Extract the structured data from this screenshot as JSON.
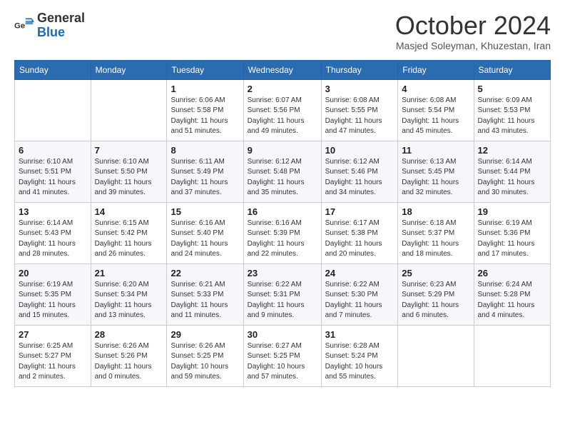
{
  "logo": {
    "general": "General",
    "blue": "Blue"
  },
  "title": "October 2024",
  "subtitle": "Masjed Soleyman, Khuzestan, Iran",
  "days_of_week": [
    "Sunday",
    "Monday",
    "Tuesday",
    "Wednesday",
    "Thursday",
    "Friday",
    "Saturday"
  ],
  "weeks": [
    [
      {
        "day": "",
        "sunrise": "",
        "sunset": "",
        "daylight": ""
      },
      {
        "day": "",
        "sunrise": "",
        "sunset": "",
        "daylight": ""
      },
      {
        "day": "1",
        "sunrise": "Sunrise: 6:06 AM",
        "sunset": "Sunset: 5:58 PM",
        "daylight": "Daylight: 11 hours and 51 minutes."
      },
      {
        "day": "2",
        "sunrise": "Sunrise: 6:07 AM",
        "sunset": "Sunset: 5:56 PM",
        "daylight": "Daylight: 11 hours and 49 minutes."
      },
      {
        "day": "3",
        "sunrise": "Sunrise: 6:08 AM",
        "sunset": "Sunset: 5:55 PM",
        "daylight": "Daylight: 11 hours and 47 minutes."
      },
      {
        "day": "4",
        "sunrise": "Sunrise: 6:08 AM",
        "sunset": "Sunset: 5:54 PM",
        "daylight": "Daylight: 11 hours and 45 minutes."
      },
      {
        "day": "5",
        "sunrise": "Sunrise: 6:09 AM",
        "sunset": "Sunset: 5:53 PM",
        "daylight": "Daylight: 11 hours and 43 minutes."
      }
    ],
    [
      {
        "day": "6",
        "sunrise": "Sunrise: 6:10 AM",
        "sunset": "Sunset: 5:51 PM",
        "daylight": "Daylight: 11 hours and 41 minutes."
      },
      {
        "day": "7",
        "sunrise": "Sunrise: 6:10 AM",
        "sunset": "Sunset: 5:50 PM",
        "daylight": "Daylight: 11 hours and 39 minutes."
      },
      {
        "day": "8",
        "sunrise": "Sunrise: 6:11 AM",
        "sunset": "Sunset: 5:49 PM",
        "daylight": "Daylight: 11 hours and 37 minutes."
      },
      {
        "day": "9",
        "sunrise": "Sunrise: 6:12 AM",
        "sunset": "Sunset: 5:48 PM",
        "daylight": "Daylight: 11 hours and 35 minutes."
      },
      {
        "day": "10",
        "sunrise": "Sunrise: 6:12 AM",
        "sunset": "Sunset: 5:46 PM",
        "daylight": "Daylight: 11 hours and 34 minutes."
      },
      {
        "day": "11",
        "sunrise": "Sunrise: 6:13 AM",
        "sunset": "Sunset: 5:45 PM",
        "daylight": "Daylight: 11 hours and 32 minutes."
      },
      {
        "day": "12",
        "sunrise": "Sunrise: 6:14 AM",
        "sunset": "Sunset: 5:44 PM",
        "daylight": "Daylight: 11 hours and 30 minutes."
      }
    ],
    [
      {
        "day": "13",
        "sunrise": "Sunrise: 6:14 AM",
        "sunset": "Sunset: 5:43 PM",
        "daylight": "Daylight: 11 hours and 28 minutes."
      },
      {
        "day": "14",
        "sunrise": "Sunrise: 6:15 AM",
        "sunset": "Sunset: 5:42 PM",
        "daylight": "Daylight: 11 hours and 26 minutes."
      },
      {
        "day": "15",
        "sunrise": "Sunrise: 6:16 AM",
        "sunset": "Sunset: 5:40 PM",
        "daylight": "Daylight: 11 hours and 24 minutes."
      },
      {
        "day": "16",
        "sunrise": "Sunrise: 6:16 AM",
        "sunset": "Sunset: 5:39 PM",
        "daylight": "Daylight: 11 hours and 22 minutes."
      },
      {
        "day": "17",
        "sunrise": "Sunrise: 6:17 AM",
        "sunset": "Sunset: 5:38 PM",
        "daylight": "Daylight: 11 hours and 20 minutes."
      },
      {
        "day": "18",
        "sunrise": "Sunrise: 6:18 AM",
        "sunset": "Sunset: 5:37 PM",
        "daylight": "Daylight: 11 hours and 18 minutes."
      },
      {
        "day": "19",
        "sunrise": "Sunrise: 6:19 AM",
        "sunset": "Sunset: 5:36 PM",
        "daylight": "Daylight: 11 hours and 17 minutes."
      }
    ],
    [
      {
        "day": "20",
        "sunrise": "Sunrise: 6:19 AM",
        "sunset": "Sunset: 5:35 PM",
        "daylight": "Daylight: 11 hours and 15 minutes."
      },
      {
        "day": "21",
        "sunrise": "Sunrise: 6:20 AM",
        "sunset": "Sunset: 5:34 PM",
        "daylight": "Daylight: 11 hours and 13 minutes."
      },
      {
        "day": "22",
        "sunrise": "Sunrise: 6:21 AM",
        "sunset": "Sunset: 5:33 PM",
        "daylight": "Daylight: 11 hours and 11 minutes."
      },
      {
        "day": "23",
        "sunrise": "Sunrise: 6:22 AM",
        "sunset": "Sunset: 5:31 PM",
        "daylight": "Daylight: 11 hours and 9 minutes."
      },
      {
        "day": "24",
        "sunrise": "Sunrise: 6:22 AM",
        "sunset": "Sunset: 5:30 PM",
        "daylight": "Daylight: 11 hours and 7 minutes."
      },
      {
        "day": "25",
        "sunrise": "Sunrise: 6:23 AM",
        "sunset": "Sunset: 5:29 PM",
        "daylight": "Daylight: 11 hours and 6 minutes."
      },
      {
        "day": "26",
        "sunrise": "Sunrise: 6:24 AM",
        "sunset": "Sunset: 5:28 PM",
        "daylight": "Daylight: 11 hours and 4 minutes."
      }
    ],
    [
      {
        "day": "27",
        "sunrise": "Sunrise: 6:25 AM",
        "sunset": "Sunset: 5:27 PM",
        "daylight": "Daylight: 11 hours and 2 minutes."
      },
      {
        "day": "28",
        "sunrise": "Sunrise: 6:26 AM",
        "sunset": "Sunset: 5:26 PM",
        "daylight": "Daylight: 11 hours and 0 minutes."
      },
      {
        "day": "29",
        "sunrise": "Sunrise: 6:26 AM",
        "sunset": "Sunset: 5:25 PM",
        "daylight": "Daylight: 10 hours and 59 minutes."
      },
      {
        "day": "30",
        "sunrise": "Sunrise: 6:27 AM",
        "sunset": "Sunset: 5:25 PM",
        "daylight": "Daylight: 10 hours and 57 minutes."
      },
      {
        "day": "31",
        "sunrise": "Sunrise: 6:28 AM",
        "sunset": "Sunset: 5:24 PM",
        "daylight": "Daylight: 10 hours and 55 minutes."
      },
      {
        "day": "",
        "sunrise": "",
        "sunset": "",
        "daylight": ""
      },
      {
        "day": "",
        "sunrise": "",
        "sunset": "",
        "daylight": ""
      }
    ]
  ]
}
